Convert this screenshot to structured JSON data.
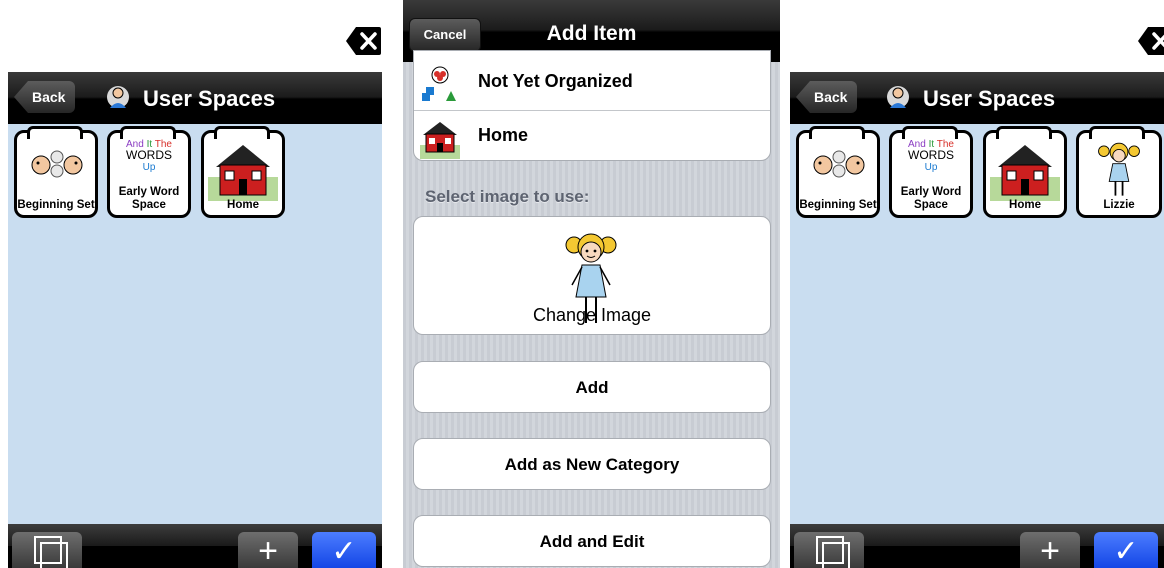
{
  "left_screen": {
    "nav": {
      "back_label": "Back",
      "title": "User Spaces"
    },
    "tiles": [
      {
        "label": "Beginning Set"
      },
      {
        "label": "Early Word Space"
      },
      {
        "label": "Home"
      }
    ],
    "word_art": {
      "and": "And",
      "it": "It",
      "the": "The",
      "words": "WORDS",
      "up": "Up"
    }
  },
  "middle_screen": {
    "nav": {
      "cancel_label": "Cancel",
      "title": "Add Item"
    },
    "list": [
      {
        "label": "Not Yet Organized"
      },
      {
        "label": "Home"
      }
    ],
    "section_title": "Select image to use:",
    "image_button": {
      "label": "Change Image"
    },
    "buttons": [
      {
        "label": "Add"
      },
      {
        "label": "Add as New Category"
      },
      {
        "label": "Add and Edit"
      }
    ]
  },
  "right_screen": {
    "nav": {
      "back_label": "Back",
      "title": "User Spaces"
    },
    "tiles": [
      {
        "label": "Beginning Set"
      },
      {
        "label": "Early Word Space"
      },
      {
        "label": "Home"
      },
      {
        "label": "Lizzie"
      }
    ],
    "word_art": {
      "and": "And",
      "it": "It",
      "the": "The",
      "words": "WORDS",
      "up": "Up"
    }
  },
  "toolbar": {
    "plus": "+",
    "check": "✓"
  },
  "colors": {
    "accent_blue": "#1f52f0",
    "background": "#c9ddf0"
  }
}
